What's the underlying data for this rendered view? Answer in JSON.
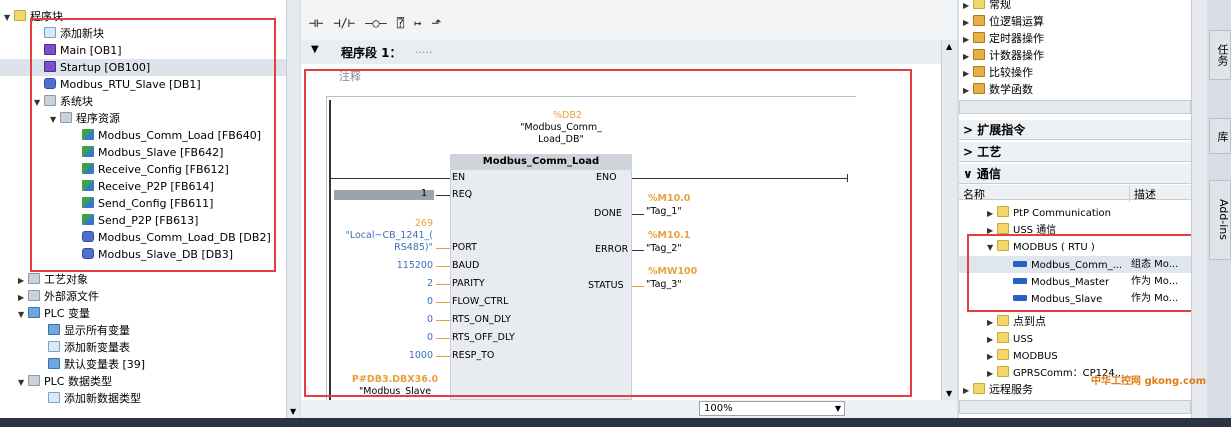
{
  "tree": {
    "root": "程序块",
    "add_block": "添加新块",
    "main": "Main [OB1]",
    "startup": "Startup [OB100]",
    "modbus_rtu_slave": "Modbus_RTU_Slave [DB1]",
    "system_blocks": "系统块",
    "program_resources": "程序资源",
    "items": [
      "Modbus_Comm_Load [FB640]",
      "Modbus_Slave [FB642]",
      "Receive_Config [FB612]",
      "Receive_P2P [FB614]",
      "Send_Config [FB611]",
      "Send_P2P [FB613]",
      "Modbus_Comm_Load_DB [DB2]",
      "Modbus_Slave_DB [DB3]"
    ],
    "tech_objects": "工艺对象",
    "external_sources": "外部源文件",
    "plc_tags": "PLC 变量",
    "show_all_tags": "显示所有变量",
    "add_tag_table": "添加新变量表",
    "default_tag_table": "默认变量表 [39]",
    "plc_data_types": "PLC 数据类型",
    "add_data_type": "添加新数据类型"
  },
  "editor": {
    "network_title": "程序段 1：",
    "network_dots": ".....",
    "comment_label": "注释",
    "instance_db_addr": "%DB2",
    "instance_db_name_1": "\"Modbus_Comm_",
    "instance_db_name_2": "Load_DB\"",
    "block_name": "Modbus_Comm_Load",
    "pin_en": "EN",
    "pin_eno": "ENO",
    "inputs": [
      {
        "pin": "REQ",
        "value": "1"
      },
      {
        "pin": "PORT",
        "value": "269",
        "value_2": "\"Local~CB_1241_(",
        "value_3": "RS485)\""
      },
      {
        "pin": "BAUD",
        "value": "115200"
      },
      {
        "pin": "PARITY",
        "value": "2"
      },
      {
        "pin": "FLOW_CTRL",
        "value": "0"
      },
      {
        "pin": "RTS_ON_DLY",
        "value": "0"
      },
      {
        "pin": "RTS_OFF_DLY",
        "value": "0"
      },
      {
        "pin": "RESP_TO",
        "value": "1000"
      }
    ],
    "mb_db_addr": "P#DB3.DBX36.0",
    "mb_db_name": "\"Modbus_Slave",
    "outputs": [
      {
        "pin": "DONE",
        "addr": "%M10.0",
        "tag": "\"Tag_1\""
      },
      {
        "pin": "ERROR",
        "addr": "%M10.1",
        "tag": "\"Tag_2\""
      },
      {
        "pin": "STATUS",
        "addr": "%MW100",
        "tag": "\"Tag_3\""
      }
    ],
    "zoom": "100%"
  },
  "instructions": {
    "basic_items": [
      "常规",
      "位逻辑运算",
      "定时器操作",
      "计数器操作",
      "比较操作",
      "数学函数"
    ],
    "extended": "扩展指令",
    "technology": "工艺",
    "communication": "通信",
    "col_name": "名称",
    "col_desc": "描述",
    "comm_items": [
      "PtP Communication",
      "USS 通信",
      "MODBUS ( RTU )"
    ],
    "modbus_children": [
      {
        "name": "Modbus_Comm_...",
        "desc": "组态 Mo..."
      },
      {
        "name": "Modbus_Master",
        "desc": "作为 Mo..."
      },
      {
        "name": "Modbus_Slave",
        "desc": "作为 Mo..."
      }
    ],
    "after_items": [
      "点到点",
      "USS",
      "MODBUS",
      "GPRSComm：CP124..."
    ],
    "remote_service": "远程服务"
  },
  "vtabs": [
    "任务",
    "库",
    "Add-ins"
  ],
  "watermark": "中华工控网 gkong.com"
}
